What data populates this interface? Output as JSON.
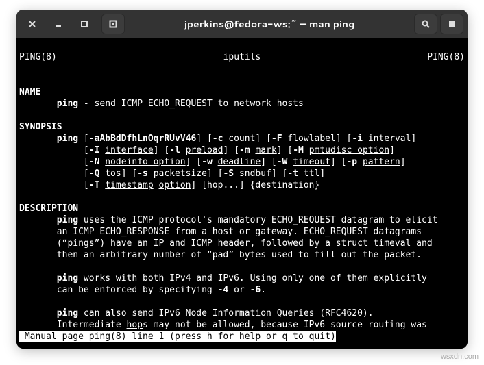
{
  "window": {
    "title": "jperkins@fedora-ws:~ — man ping"
  },
  "man": {
    "hdr_left": "PING(8)",
    "hdr_center": "iputils",
    "hdr_right": "PING(8)",
    "sec_name": "NAME",
    "name_cmd": "ping",
    "name_text": " - send ICMP ECHO_REQUEST to network hosts",
    "sec_synopsis": "SYNOPSIS",
    "syn": {
      "cmd": "ping",
      "f1": "-aAbBdDfhLnOqrRUvV46",
      "f_c": "-c",
      "a_count": "count",
      "f_F": "-F",
      "a_flow": "flowlabel",
      "f_i": "-i",
      "a_interval": "interval",
      "f_I": "-I",
      "a_interface": "interface",
      "f_l": "-l",
      "a_preload": "preload",
      "f_m": "-m",
      "a_mark": "mark",
      "f_M": "-M",
      "a_pmtu": "pmtudisc option",
      "f_N": "-N",
      "a_node": "nodeinfo option",
      "f_w": "-w",
      "a_deadline": "deadline",
      "f_W": "-W",
      "a_timeout": "timeout",
      "f_p": "-p",
      "a_pattern": "pattern",
      "f_Q": "-Q",
      "a_tos": "tos",
      "f_s": "-s",
      "a_pkt": "packetsize",
      "f_S": "-S",
      "a_snd": "sndbuf",
      "f_t": "-t",
      "a_ttl": "ttl",
      "f_T": "-T",
      "a_ts1": "timestamp",
      "a_ts2": "option",
      "tail": "] [hop...] {destination}"
    },
    "sec_desc": "DESCRIPTION",
    "d1a": "ping",
    "d1b": " uses the ICMP protocol's mandatory ECHO_REQUEST datagram to elicit",
    "d1c": "       an ICMP ECHO_RESPONSE from a host or gateway. ECHO_REQUEST datagrams",
    "d1d": "       (“pings”) have an IP and ICMP header, followed by a struct timeval and",
    "d1e": "       then an arbitrary number of “pad” bytes used to fill out the packet.",
    "d2a": "ping",
    "d2b": " works with both IPv4 and IPv6. Using only one of them explicitly",
    "d2c": "       can be enforced by specifying ",
    "d2d": "-4",
    "d2e": " or ",
    "d2f": "-6",
    "d2g": ".",
    "d3a": "ping",
    "d3b": " can also send IPv6 Node Information Queries (RFC4620).",
    "d3c": "       Intermediate ",
    "d3d": "hop",
    "d3e": "s may not be allowed, because IPv6 source routing was",
    "status": " Manual page ping(8) line 1 (press h for help or q to quit)"
  },
  "watermark": "wsxdn.com"
}
